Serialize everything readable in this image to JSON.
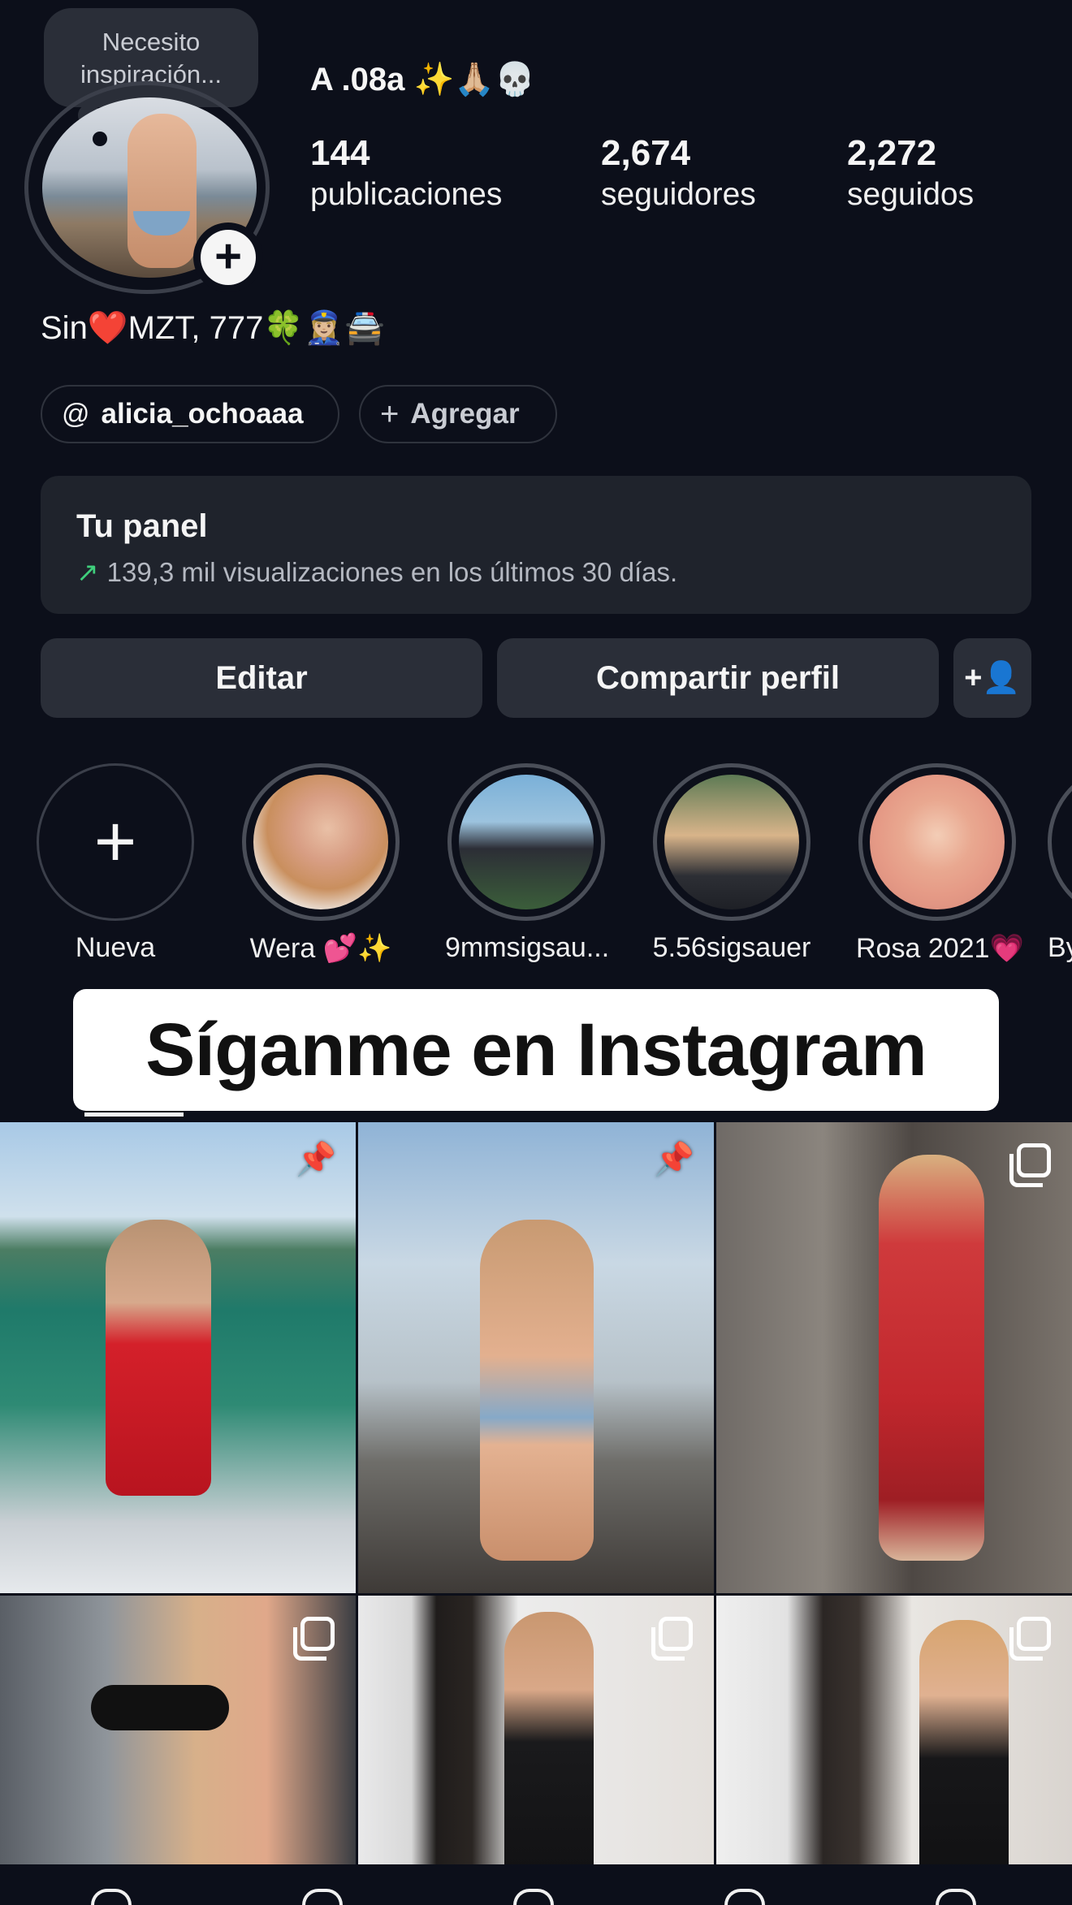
{
  "note": {
    "text_line1": "Necesito",
    "text_line2": "inspiración..."
  },
  "profile": {
    "username": "A .08a ✨🙏🏼💀",
    "bio": "Sin❤️MZT, 777🍀👮🏼‍♀️🚔",
    "stats": [
      {
        "value": "144",
        "label": "publicaciones"
      },
      {
        "value": "2,674",
        "label": "seguidores"
      },
      {
        "value": "2,272",
        "label": "seguidos"
      }
    ]
  },
  "links": {
    "threads_handle": "alicia_ochoaaa",
    "add_label": "Agregar"
  },
  "panel": {
    "title": "Tu panel",
    "subtitle": "139,3 mil visualizaciones en los últimos 30 días."
  },
  "actions": {
    "edit_label": "Editar",
    "share_label": "Compartir perfil"
  },
  "highlights": [
    {
      "label": "Nueva"
    },
    {
      "label": "Wera 💕✨"
    },
    {
      "label": "9mmsigsau..."
    },
    {
      "label": "5.56sigsauer"
    },
    {
      "label": "Rosa 2021💗"
    },
    {
      "label": "By"
    }
  ],
  "caption": "Síganme en Instagram",
  "colors": {
    "background": "#0c0f1a",
    "panel": "#1f232c",
    "button": "#2a2e38",
    "accent_green": "#3fcf7c"
  }
}
